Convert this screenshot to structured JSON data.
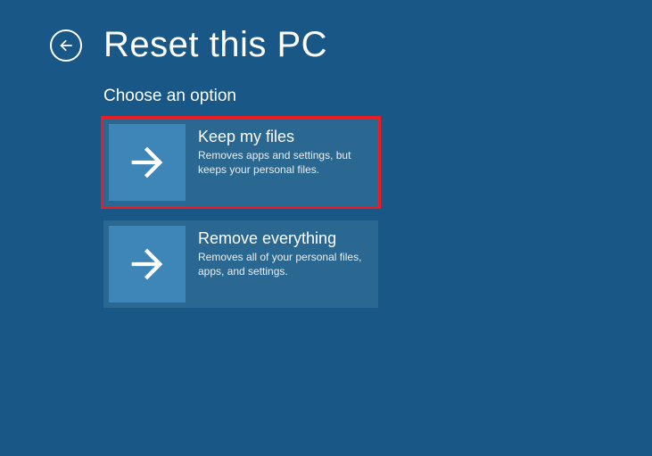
{
  "header": {
    "title": "Reset this PC"
  },
  "subtitle": "Choose an option",
  "options": [
    {
      "label": "Keep my files",
      "desc": "Removes apps and settings, but keeps your personal files.",
      "highlight": true
    },
    {
      "label": "Remove everything",
      "desc": "Removes all of your personal files, apps, and settings.",
      "highlight": false
    }
  ]
}
